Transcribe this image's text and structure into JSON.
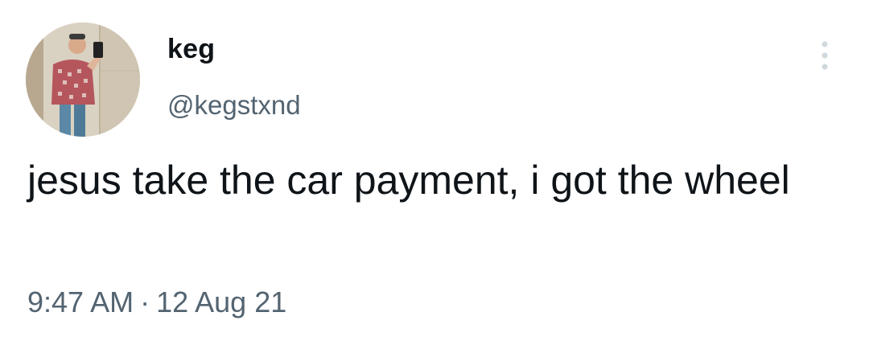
{
  "tweet": {
    "author": {
      "name": "keg",
      "handle": "@kegstxnd"
    },
    "text": "jesus take the car payment, i got the wheel",
    "time": "9:47 AM",
    "separator": "·",
    "date": "12 Aug 21"
  },
  "icons": {
    "more": "more-vertical-icon"
  },
  "colors": {
    "text_primary": "#0f1419",
    "text_secondary": "#536471",
    "background": "#ffffff",
    "icon": "#cfd9de"
  }
}
